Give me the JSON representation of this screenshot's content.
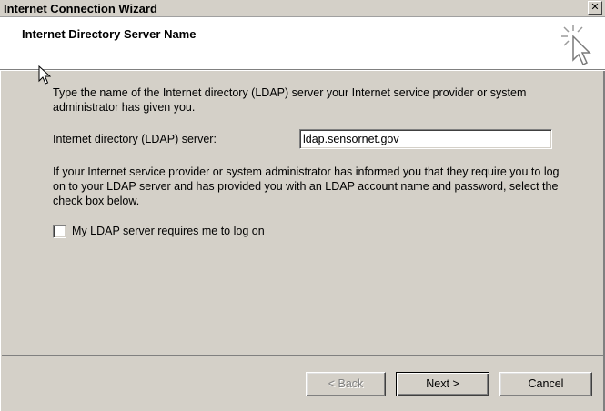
{
  "window": {
    "title": "Internet Connection Wizard",
    "close_glyph": "✕"
  },
  "header": {
    "title": "Internet Directory Server Name",
    "icon": "wizard-cursor-sparkle-icon"
  },
  "main": {
    "intro_text": "Type the name of the Internet directory (LDAP) server your Internet service provider or system administrator has given you.",
    "server_label": "Internet directory (LDAP) server:",
    "server_value": "ldap.sensornet.gov",
    "info_text": "If your Internet service provider or system administrator has informed you that they require you to log on to your LDAP server and has provided you with an LDAP account name and password, select the check box below.",
    "checkbox_label": "My LDAP server requires me to log on",
    "checkbox_checked": false
  },
  "footer": {
    "back_label": "< Back",
    "next_label": "Next >",
    "cancel_label": "Cancel"
  },
  "colors": {
    "dialog_bg": "#d4d0c8",
    "header_bg": "#ffffff",
    "disabled_text": "#808080"
  }
}
